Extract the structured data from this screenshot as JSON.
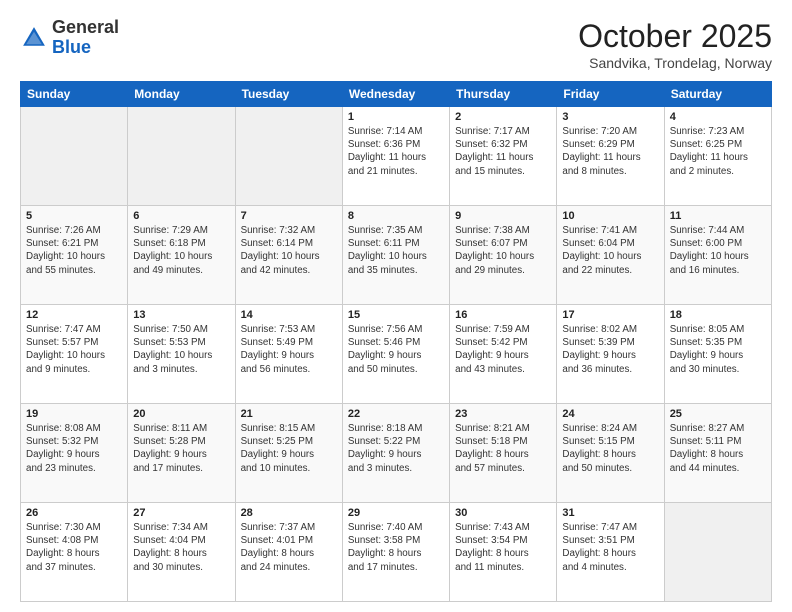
{
  "header": {
    "logo_general": "General",
    "logo_blue": "Blue",
    "month": "October 2025",
    "location": "Sandvika, Trondelag, Norway"
  },
  "days_of_week": [
    "Sunday",
    "Monday",
    "Tuesday",
    "Wednesday",
    "Thursday",
    "Friday",
    "Saturday"
  ],
  "weeks": [
    [
      {
        "day": "",
        "info": ""
      },
      {
        "day": "",
        "info": ""
      },
      {
        "day": "",
        "info": ""
      },
      {
        "day": "1",
        "info": "Sunrise: 7:14 AM\nSunset: 6:36 PM\nDaylight: 11 hours\nand 21 minutes."
      },
      {
        "day": "2",
        "info": "Sunrise: 7:17 AM\nSunset: 6:32 PM\nDaylight: 11 hours\nand 15 minutes."
      },
      {
        "day": "3",
        "info": "Sunrise: 7:20 AM\nSunset: 6:29 PM\nDaylight: 11 hours\nand 8 minutes."
      },
      {
        "day": "4",
        "info": "Sunrise: 7:23 AM\nSunset: 6:25 PM\nDaylight: 11 hours\nand 2 minutes."
      }
    ],
    [
      {
        "day": "5",
        "info": "Sunrise: 7:26 AM\nSunset: 6:21 PM\nDaylight: 10 hours\nand 55 minutes."
      },
      {
        "day": "6",
        "info": "Sunrise: 7:29 AM\nSunset: 6:18 PM\nDaylight: 10 hours\nand 49 minutes."
      },
      {
        "day": "7",
        "info": "Sunrise: 7:32 AM\nSunset: 6:14 PM\nDaylight: 10 hours\nand 42 minutes."
      },
      {
        "day": "8",
        "info": "Sunrise: 7:35 AM\nSunset: 6:11 PM\nDaylight: 10 hours\nand 35 minutes."
      },
      {
        "day": "9",
        "info": "Sunrise: 7:38 AM\nSunset: 6:07 PM\nDaylight: 10 hours\nand 29 minutes."
      },
      {
        "day": "10",
        "info": "Sunrise: 7:41 AM\nSunset: 6:04 PM\nDaylight: 10 hours\nand 22 minutes."
      },
      {
        "day": "11",
        "info": "Sunrise: 7:44 AM\nSunset: 6:00 PM\nDaylight: 10 hours\nand 16 minutes."
      }
    ],
    [
      {
        "day": "12",
        "info": "Sunrise: 7:47 AM\nSunset: 5:57 PM\nDaylight: 10 hours\nand 9 minutes."
      },
      {
        "day": "13",
        "info": "Sunrise: 7:50 AM\nSunset: 5:53 PM\nDaylight: 10 hours\nand 3 minutes."
      },
      {
        "day": "14",
        "info": "Sunrise: 7:53 AM\nSunset: 5:49 PM\nDaylight: 9 hours\nand 56 minutes."
      },
      {
        "day": "15",
        "info": "Sunrise: 7:56 AM\nSunset: 5:46 PM\nDaylight: 9 hours\nand 50 minutes."
      },
      {
        "day": "16",
        "info": "Sunrise: 7:59 AM\nSunset: 5:42 PM\nDaylight: 9 hours\nand 43 minutes."
      },
      {
        "day": "17",
        "info": "Sunrise: 8:02 AM\nSunset: 5:39 PM\nDaylight: 9 hours\nand 36 minutes."
      },
      {
        "day": "18",
        "info": "Sunrise: 8:05 AM\nSunset: 5:35 PM\nDaylight: 9 hours\nand 30 minutes."
      }
    ],
    [
      {
        "day": "19",
        "info": "Sunrise: 8:08 AM\nSunset: 5:32 PM\nDaylight: 9 hours\nand 23 minutes."
      },
      {
        "day": "20",
        "info": "Sunrise: 8:11 AM\nSunset: 5:28 PM\nDaylight: 9 hours\nand 17 minutes."
      },
      {
        "day": "21",
        "info": "Sunrise: 8:15 AM\nSunset: 5:25 PM\nDaylight: 9 hours\nand 10 minutes."
      },
      {
        "day": "22",
        "info": "Sunrise: 8:18 AM\nSunset: 5:22 PM\nDaylight: 9 hours\nand 3 minutes."
      },
      {
        "day": "23",
        "info": "Sunrise: 8:21 AM\nSunset: 5:18 PM\nDaylight: 8 hours\nand 57 minutes."
      },
      {
        "day": "24",
        "info": "Sunrise: 8:24 AM\nSunset: 5:15 PM\nDaylight: 8 hours\nand 50 minutes."
      },
      {
        "day": "25",
        "info": "Sunrise: 8:27 AM\nSunset: 5:11 PM\nDaylight: 8 hours\nand 44 minutes."
      }
    ],
    [
      {
        "day": "26",
        "info": "Sunrise: 7:30 AM\nSunset: 4:08 PM\nDaylight: 8 hours\nand 37 minutes."
      },
      {
        "day": "27",
        "info": "Sunrise: 7:34 AM\nSunset: 4:04 PM\nDaylight: 8 hours\nand 30 minutes."
      },
      {
        "day": "28",
        "info": "Sunrise: 7:37 AM\nSunset: 4:01 PM\nDaylight: 8 hours\nand 24 minutes."
      },
      {
        "day": "29",
        "info": "Sunrise: 7:40 AM\nSunset: 3:58 PM\nDaylight: 8 hours\nand 17 minutes."
      },
      {
        "day": "30",
        "info": "Sunrise: 7:43 AM\nSunset: 3:54 PM\nDaylight: 8 hours\nand 11 minutes."
      },
      {
        "day": "31",
        "info": "Sunrise: 7:47 AM\nSunset: 3:51 PM\nDaylight: 8 hours\nand 4 minutes."
      },
      {
        "day": "",
        "info": ""
      }
    ]
  ]
}
